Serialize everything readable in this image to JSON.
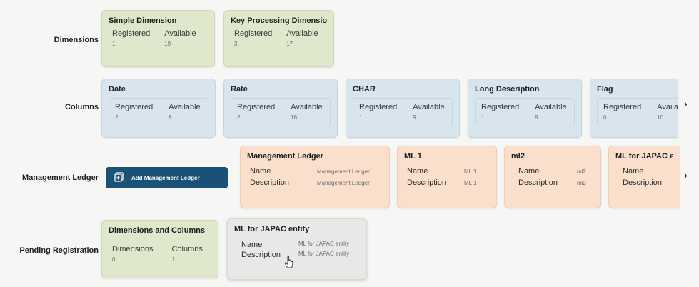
{
  "rows": {
    "dimensions": "Dimensions",
    "columns": "Columns",
    "management_ledger": "Management Ledger",
    "pending": "Pending Registration"
  },
  "dimension_cards": [
    {
      "title": "Simple Dimension",
      "registered_label": "Registered",
      "registered": "1",
      "available_label": "Available",
      "available": "19"
    },
    {
      "title": "Key Processing Dimension",
      "registered_label": "Registered",
      "registered": "3",
      "available_label": "Available",
      "available": "17"
    }
  ],
  "column_cards": [
    {
      "title": "Date",
      "registered_label": "Registered",
      "registered": "2",
      "available_label": "Available",
      "available": "8"
    },
    {
      "title": "Rate",
      "registered_label": "Registered",
      "registered": "2",
      "available_label": "Available",
      "available": "18"
    },
    {
      "title": "CHAR",
      "registered_label": "Registered",
      "registered": "1",
      "available_label": "Available",
      "available": "9"
    },
    {
      "title": "Long Description",
      "registered_label": "Registered",
      "registered": "1",
      "available_label": "Available",
      "available": "9"
    },
    {
      "title": "Flag",
      "registered_label": "Registered",
      "registered": "0",
      "available_label": "Availab",
      "available": "10"
    }
  ],
  "add_button": {
    "label": "Add Management Ledger",
    "icon": "add-ledger-icon"
  },
  "ledger_cards": [
    {
      "title": "Management Ledger",
      "name_label": "Name",
      "name": "Management Ledger",
      "desc_label": "Description",
      "desc": "Management Ledger"
    },
    {
      "title": "ML 1",
      "name_label": "Name",
      "name": "ML 1",
      "desc_label": "Description",
      "desc": "ML 1"
    },
    {
      "title": "ml2",
      "name_label": "Name",
      "name": "ml2",
      "desc_label": "Description",
      "desc": "ml2"
    },
    {
      "title": "ML for JAPAC ent",
      "name_label": "Name",
      "name": "",
      "desc_label": "Description",
      "desc": ""
    }
  ],
  "pending_cards": [
    {
      "title": "Dimensions and Columns",
      "dimensions_label": "Dimensions",
      "dimensions": "0",
      "columns_label": "Columns",
      "columns": "1"
    }
  ],
  "pending_ledger_card": {
    "title": "ML for JAPAC entity",
    "name_label": "Name",
    "name": "ML for JAPAC entity",
    "desc_label": "Description",
    "desc": "ML for JAPAC entity"
  },
  "chevron": "›",
  "colors": {
    "green": "#dfe8cc",
    "blue": "#d9e5ee",
    "orange": "#fadfcc",
    "gray": "#e9e8e6",
    "button": "#1a5277"
  }
}
